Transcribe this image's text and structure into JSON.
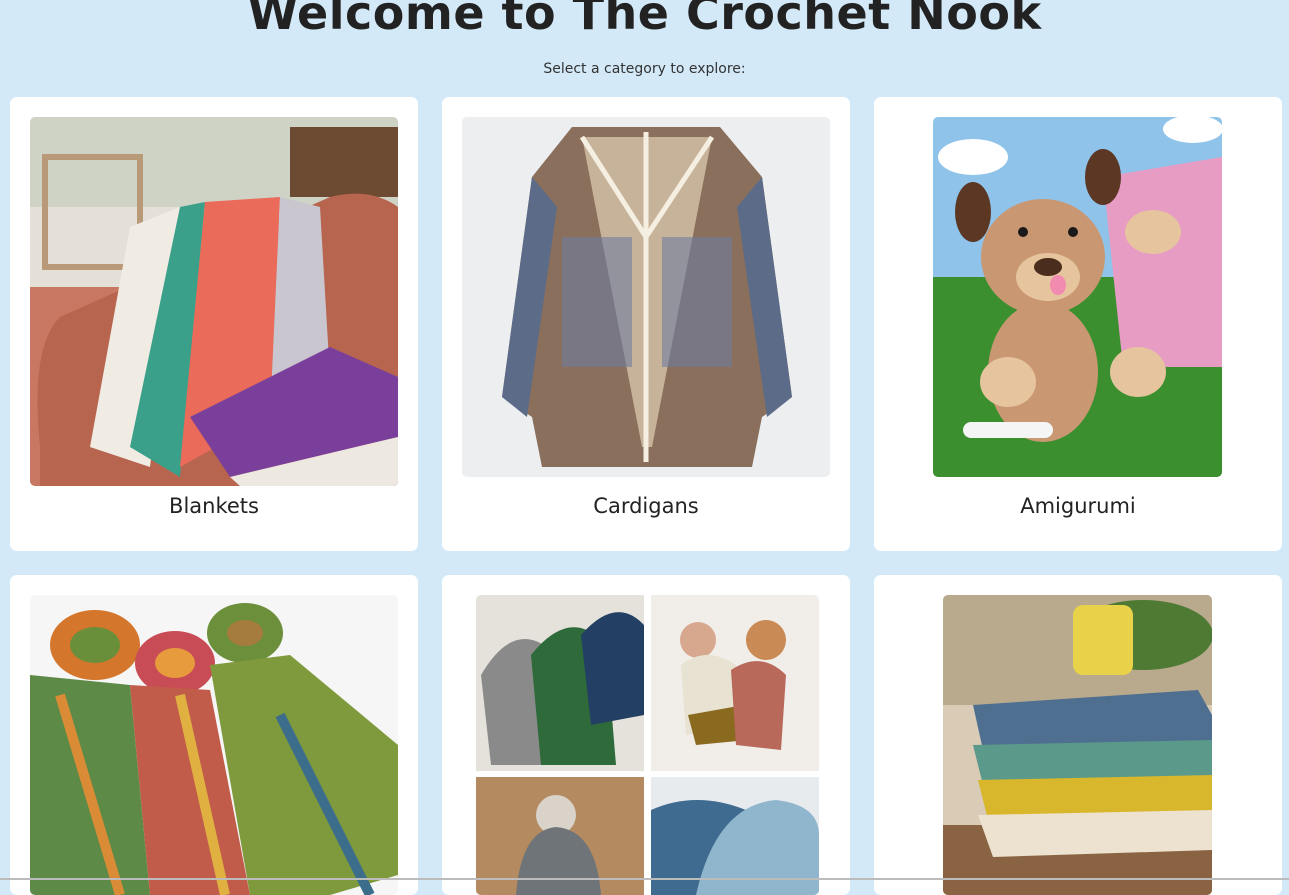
{
  "header": {
    "title": "Welcome to The Crochet Nook",
    "subtitle": "Select a category to explore:"
  },
  "categories": [
    {
      "label": "Blankets",
      "image": "blanket-photo"
    },
    {
      "label": "Cardigans",
      "image": "cardigan-photo"
    },
    {
      "label": "Amigurumi",
      "image": "amigurumi-dog-photo"
    },
    {
      "label": "",
      "image": "scarves-photo"
    },
    {
      "label": "",
      "image": "beanies-collage-photo"
    },
    {
      "label": "",
      "image": "washcloths-stack-photo"
    }
  ],
  "colors": {
    "background": "#d3e9f8",
    "card": "#ffffff",
    "text": "#222222"
  }
}
